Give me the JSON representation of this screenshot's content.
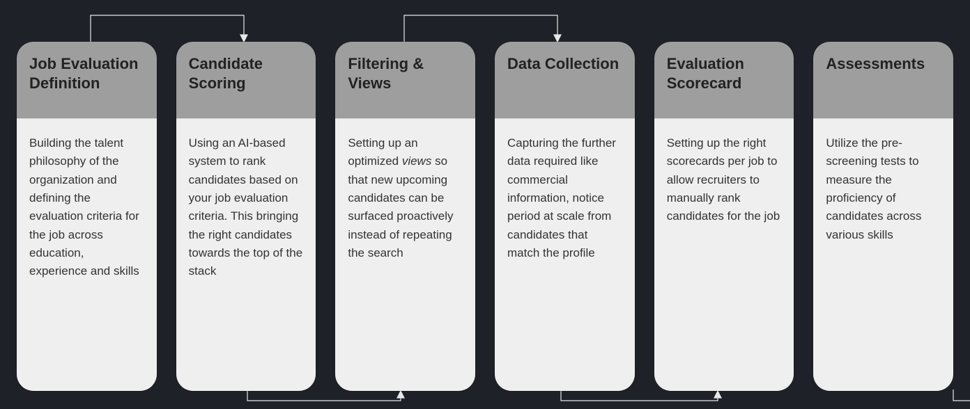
{
  "cards": [
    {
      "title": "Job Evaluation Definition",
      "body": "Building the talent philosophy of the organization and defining the evaluation criteria for the job across education, experience and skills"
    },
    {
      "title": "Candidate Scoring",
      "body": "Using an AI-based system to rank candidates based on your job evaluation criteria. This bringing the right candidates towards the top of the stack"
    },
    {
      "title": "Filtering & Views",
      "body_html": "Setting up an optimized <em>views</em> so that new upcoming candidates can be surfaced proactively instead of repeating the search"
    },
    {
      "title": "Data Collection",
      "body": "Capturing the further data required like commercial information, notice period at scale from candidates that match the profile"
    },
    {
      "title": "Evaluation Scorecard",
      "body": "Setting up the right scorecards per job to allow recruiters to manually rank candidates for the job"
    },
    {
      "title": "Assessments",
      "body": "Utilize the pre-screening tests to measure the proficiency of candidates across various skills"
    }
  ]
}
